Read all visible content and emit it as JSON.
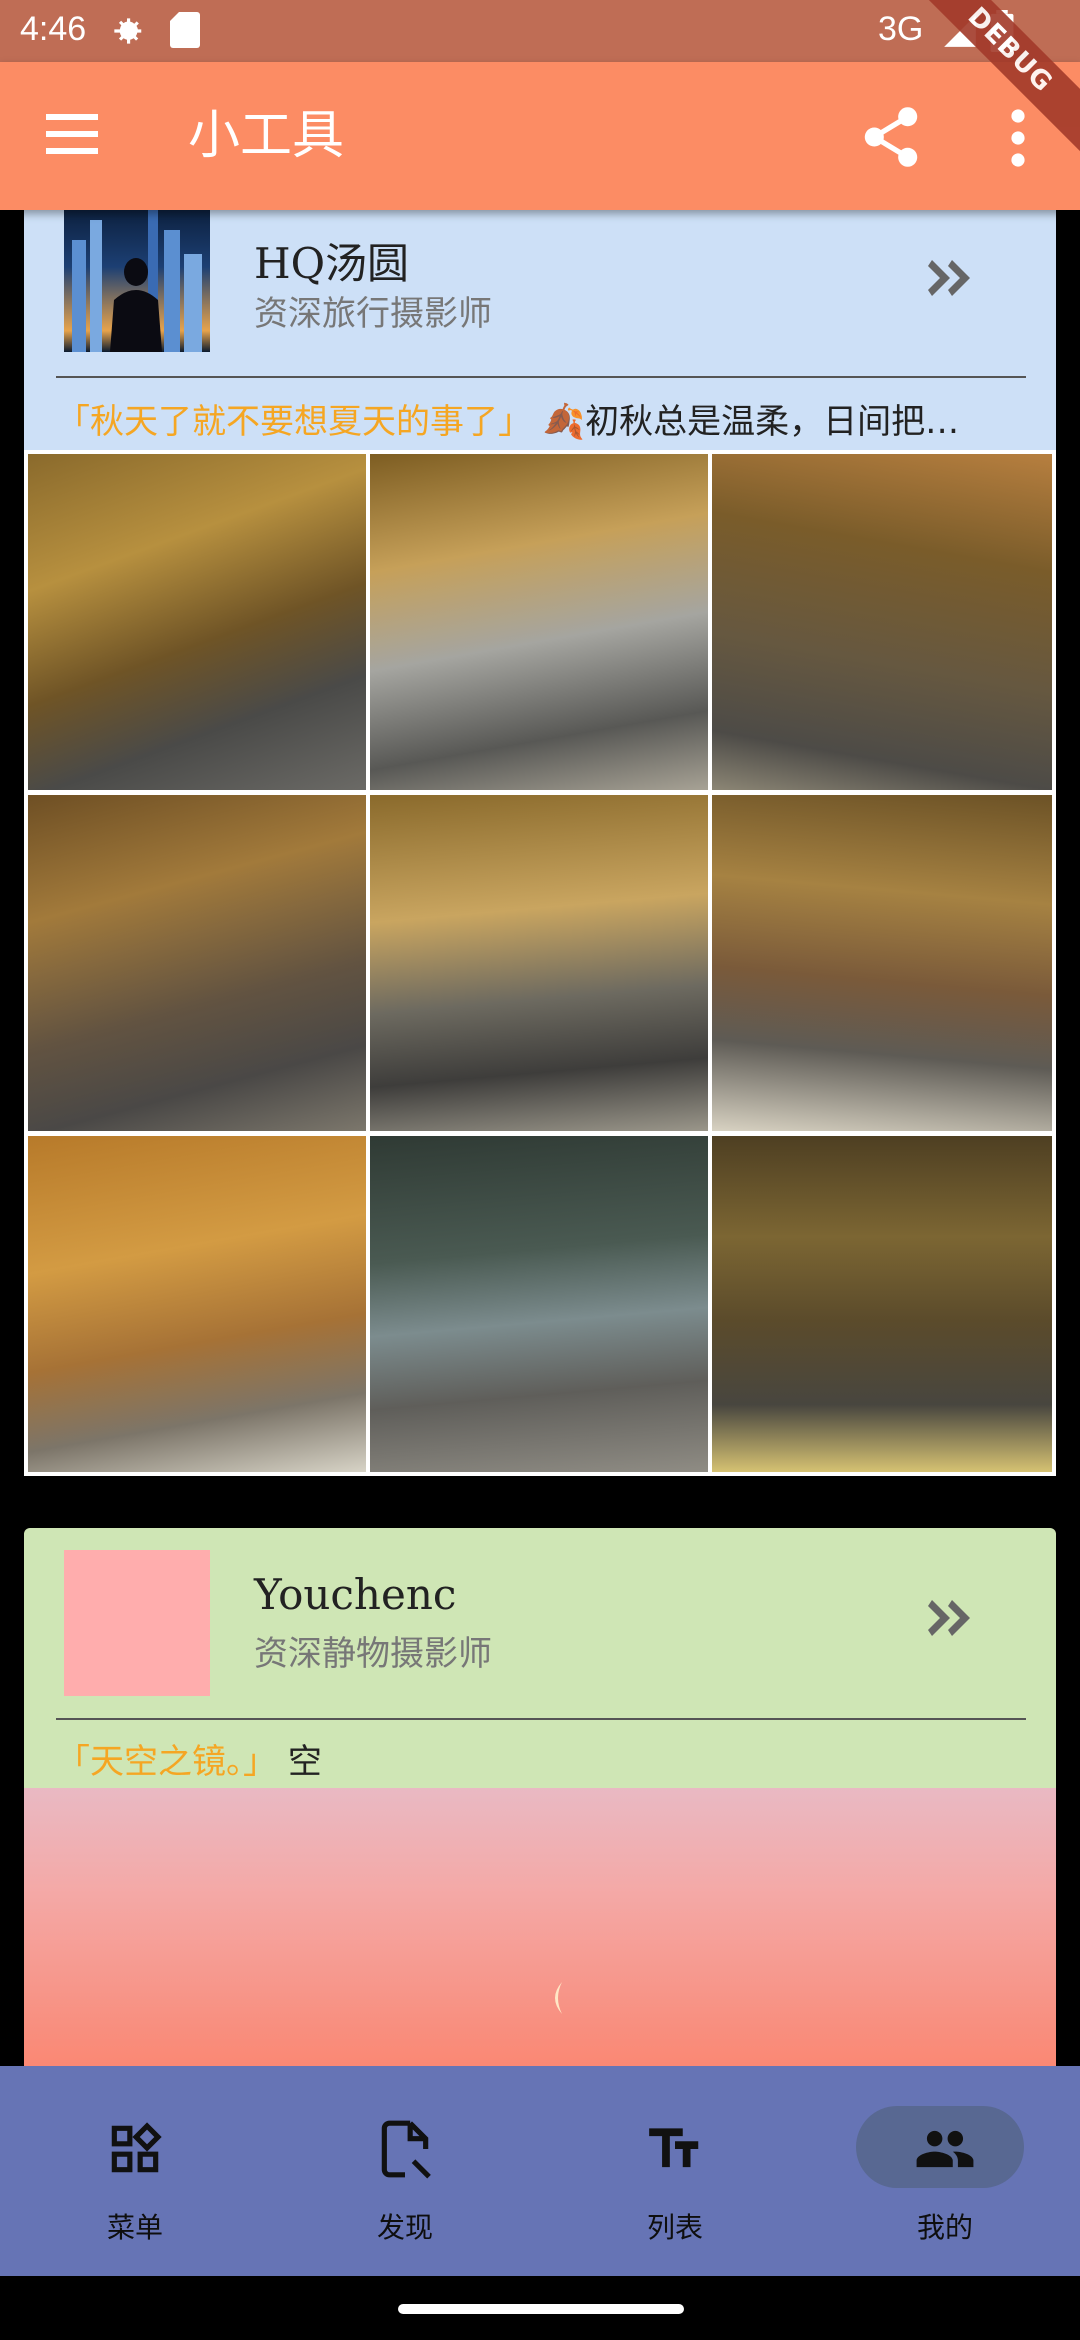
{
  "status_bar": {
    "time": "4:46",
    "network": "3G",
    "debug_banner": "DEBUG"
  },
  "app_bar": {
    "title": "小工具",
    "icons": [
      "menu-icon",
      "share-icon",
      "more-vert-icon"
    ],
    "color": "#fc8c64"
  },
  "posts": [
    {
      "author": "HQ汤圆",
      "author_title": "资深旅行摄影师",
      "quote_title": "「秋天了就不要想夏天的事了」",
      "quote_text": "🍂初秋总是温柔，日间把…",
      "card_color": "#cde0f7",
      "photo_count": 9
    },
    {
      "author": "Youchenc",
      "author_title": "资深静物摄影师",
      "quote_title": "「天空之镜。」",
      "quote_text": "空",
      "card_color": "#cfe6b5"
    }
  ],
  "bottom_nav": {
    "items": [
      {
        "label": "菜单",
        "icon": "widgets-icon"
      },
      {
        "label": "发现",
        "icon": "document-search-icon"
      },
      {
        "label": "列表",
        "icon": "text-size-icon"
      },
      {
        "label": "我的",
        "icon": "people-icon",
        "selected": true
      }
    ],
    "color": "#6674b5"
  }
}
